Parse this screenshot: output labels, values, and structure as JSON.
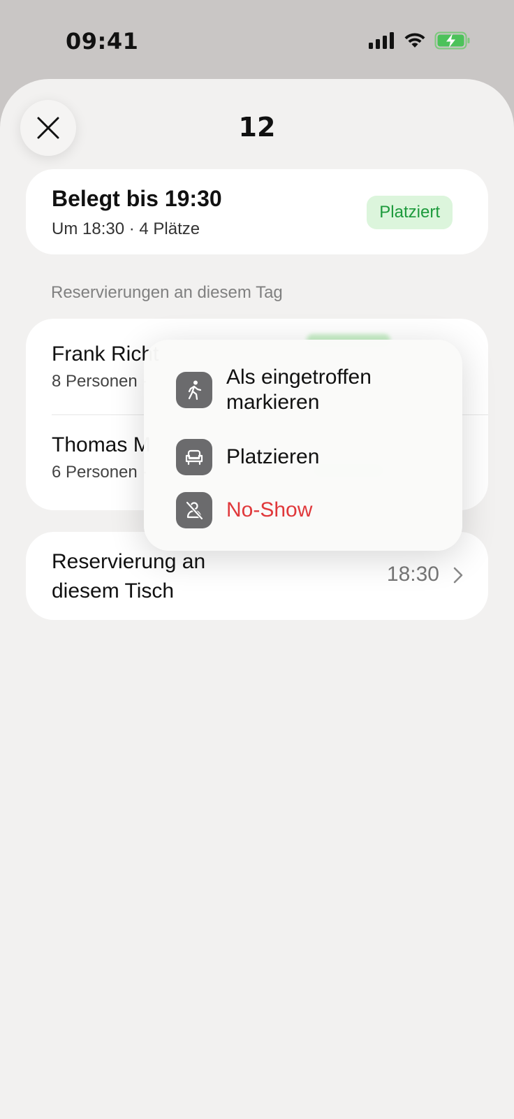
{
  "status_bar": {
    "time": "09:41"
  },
  "sheet": {
    "title": "12"
  },
  "status_card": {
    "title": "Belegt bis 19:30",
    "subtitle": "Um 18:30 · 4 Plätze",
    "badge": "Platziert"
  },
  "reservations_section": {
    "label": "Reservierungen an diesem Tag",
    "items": [
      {
        "name": "Frank Richt",
        "detail": "8 Personen ·"
      },
      {
        "name": "Thomas M",
        "detail": "6 Personen ·"
      }
    ]
  },
  "context_menu": {
    "items": [
      {
        "label": "Als eingetroffen markieren",
        "icon": "walking-person-icon"
      },
      {
        "label": "Platzieren",
        "icon": "armchair-icon"
      },
      {
        "label": "No-Show",
        "icon": "person-slash-icon"
      }
    ]
  },
  "table_reservation": {
    "label": "Reservierung an diesem Tisch",
    "time": "18:30"
  },
  "colors": {
    "badge_bg": "#dcf5dc",
    "badge_text": "#1d9a3c",
    "danger": "#e0383b",
    "icon_bg": "#6b6b6d"
  }
}
